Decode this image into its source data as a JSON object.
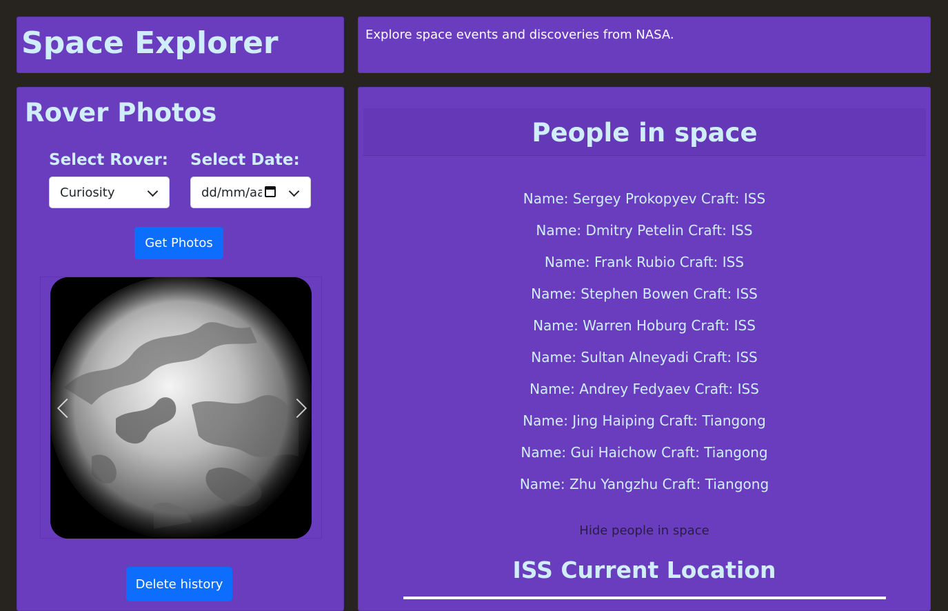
{
  "header": {
    "title": "Space Explorer"
  },
  "intro": {
    "text": "Explore space events and discoveries from NASA."
  },
  "rover": {
    "title": "Rover Photos",
    "rover_label": "Select Rover:",
    "date_label": "Select Date:",
    "rover_selected": "Curiosity",
    "date_placeholder": "dd/mm/aaaa",
    "get_photos_label": "Get Photos",
    "delete_history_label": "Delete history"
  },
  "people": {
    "title": "People in space",
    "list": [
      {
        "name_prefix": "Name:",
        "name": "Sergey Prokopyev",
        "craft_prefix": "Craft:",
        "craft": "ISS"
      },
      {
        "name_prefix": "Name:",
        "name": "Dmitry Petelin",
        "craft_prefix": "Craft:",
        "craft": "ISS"
      },
      {
        "name_prefix": "Name:",
        "name": "Frank Rubio",
        "craft_prefix": "Craft:",
        "craft": "ISS"
      },
      {
        "name_prefix": "Name:",
        "name": "Stephen Bowen",
        "craft_prefix": "Craft:",
        "craft": "ISS"
      },
      {
        "name_prefix": "Name:",
        "name": "Warren Hoburg",
        "craft_prefix": "Craft:",
        "craft": "ISS"
      },
      {
        "name_prefix": "Name:",
        "name": "Sultan Alneyadi",
        "craft_prefix": "Craft:",
        "craft": "ISS"
      },
      {
        "name_prefix": "Name:",
        "name": "Andrey Fedyaev",
        "craft_prefix": "Craft:",
        "craft": "ISS"
      },
      {
        "name_prefix": "Name:",
        "name": "Jing Haiping",
        "craft_prefix": "Craft:",
        "craft": "Tiangong"
      },
      {
        "name_prefix": "Name:",
        "name": "Gui Haichow",
        "craft_prefix": "Craft:",
        "craft": "Tiangong"
      },
      {
        "name_prefix": "Name:",
        "name": "Zhu Yangzhu",
        "craft_prefix": "Craft:",
        "craft": "Tiangong"
      }
    ],
    "hide_label": "Hide people in space"
  },
  "iss": {
    "title": "ISS Current Location"
  },
  "icons": {
    "select_chevron": "chevron-down-icon",
    "calendar": "calendar-icon",
    "carousel_prev": "chevron-left-icon",
    "carousel_next": "chevron-right-icon"
  },
  "colors": {
    "page_background": "#272420",
    "panel": "#6a3dbf",
    "heading_text": "#cfeefa",
    "primary_button": "#0d6efd"
  }
}
